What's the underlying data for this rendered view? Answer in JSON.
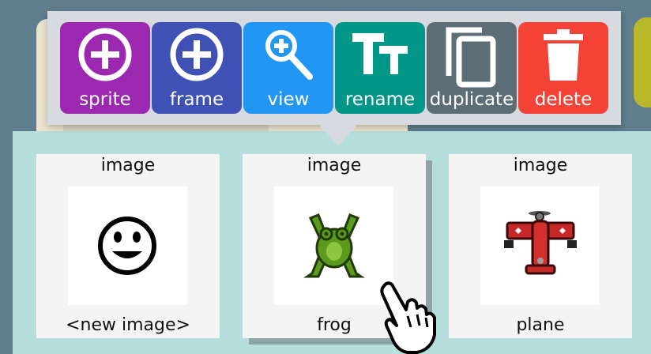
{
  "toolbar": {
    "buttons": [
      {
        "label": "sprite",
        "icon": "plus-circle-icon",
        "color": "#9c27b0"
      },
      {
        "label": "frame",
        "icon": "plus-circle-icon",
        "color": "#3f51b5"
      },
      {
        "label": "view",
        "icon": "zoom-in-icon",
        "color": "#2196f3"
      },
      {
        "label": "rename",
        "icon": "text-size-icon",
        "color": "#009688"
      },
      {
        "label": "duplicate",
        "icon": "copy-icon",
        "color": "#5d6d75"
      },
      {
        "label": "delete",
        "icon": "trash-icon",
        "color": "#f44336"
      }
    ]
  },
  "gallery": {
    "items": [
      {
        "kind": "image",
        "name": "<new image>",
        "icon": "smiley-icon",
        "selected": false
      },
      {
        "kind": "image",
        "name": "frog",
        "icon": "frog-sprite",
        "selected": true
      },
      {
        "kind": "image",
        "name": "plane",
        "icon": "plane-sprite",
        "selected": false
      }
    ]
  },
  "cursor": {
    "icon": "hand-pointer-icon"
  }
}
